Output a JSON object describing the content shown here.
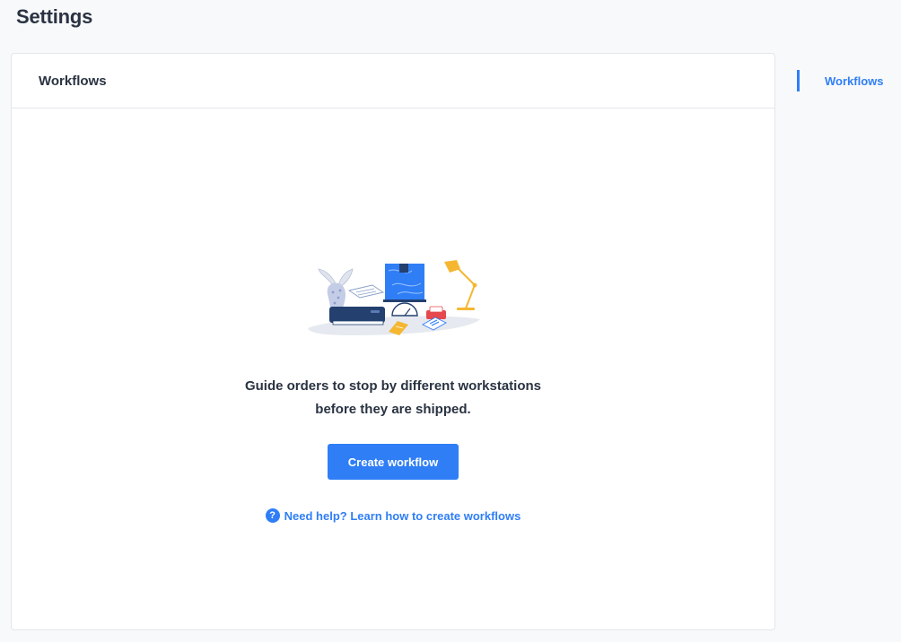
{
  "page": {
    "title": "Settings"
  },
  "card": {
    "title": "Workflows",
    "empty_state": {
      "illustration": "workstation-illustration",
      "line1": "Guide orders to stop by different workstations",
      "line2": "before they are shipped.",
      "button_label": "Create workflow",
      "help_icon": "question-circle-icon",
      "help_link": "Need help? Learn how to create workflows"
    }
  },
  "side_nav": {
    "items": [
      {
        "label": "Workflows",
        "active": true
      }
    ]
  },
  "colors": {
    "accent": "#2f7ef6",
    "heading": "#2a3342",
    "page_background": "#f8f9fb",
    "card_border": "#e3e6ea"
  }
}
